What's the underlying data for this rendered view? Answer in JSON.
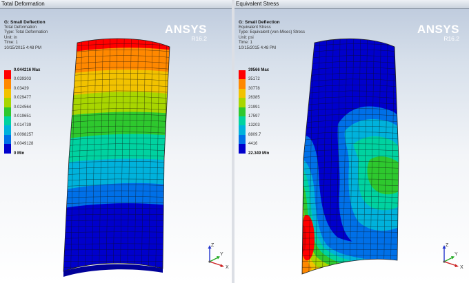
{
  "panels": [
    {
      "tab_title": "Total Deformation",
      "info_lines": [
        "G: Small Deflection",
        "Total Deformation",
        "Type: Total Deformation",
        "Unit: in",
        "Time: 1",
        "10/15/2015 4:48 PM"
      ],
      "brand": {
        "name": "ANSYS",
        "version": "R16.2"
      },
      "legend": {
        "colors": [
          "#ff0000",
          "#ff8800",
          "#f2c200",
          "#a8d600",
          "#2ec82e",
          "#00d2a0",
          "#00b2dc",
          "#0070e8",
          "#0000cc"
        ],
        "labels": [
          "0.044216 Max",
          "0.039303",
          "0.03439",
          "0.029477",
          "0.024564",
          "0.019651",
          "0.014739",
          "0.0098257",
          "0.0049128",
          "0 Min"
        ]
      }
    },
    {
      "tab_title": "Equivalent Stress",
      "info_lines": [
        "G: Small Deflection",
        "Equivalent Stress",
        "Type: Equivalent (von-Mises) Stress",
        "Unit: psi",
        "Time: 1",
        "10/15/2015 4:48 PM"
      ],
      "brand": {
        "name": "ANSYS",
        "version": "R16.2"
      },
      "legend": {
        "colors": [
          "#ff0000",
          "#ff8800",
          "#f2c200",
          "#a8d600",
          "#2ec82e",
          "#00d2a0",
          "#00b2dc",
          "#0070e8",
          "#0000cc"
        ],
        "labels": [
          "39566 Max",
          "35172",
          "30778",
          "26385",
          "21991",
          "17597",
          "13203",
          "8809.7",
          "4416",
          "22.349 Min"
        ]
      }
    }
  ],
  "triad_axes": [
    "Z",
    "Y",
    "X"
  ],
  "colors": {
    "mesh_lines": "#111111",
    "background_top": "#bcc9dc",
    "background_bottom": "#ffffff"
  }
}
